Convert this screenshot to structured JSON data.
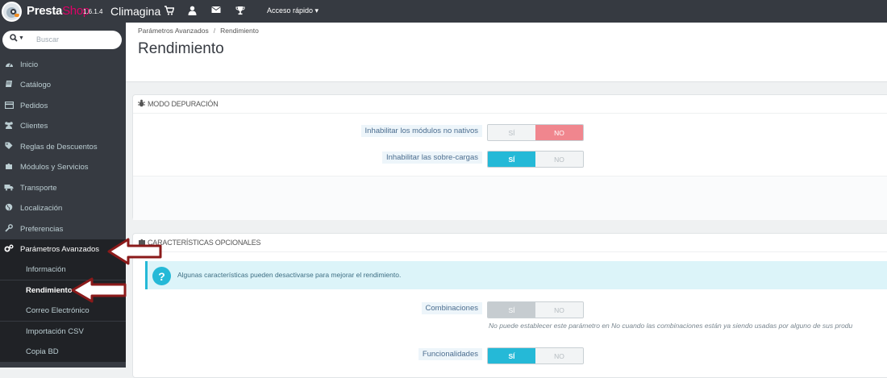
{
  "topbar": {
    "brand_part1": "Presta",
    "brand_part2": "Shop",
    "version": "1.6.1.4",
    "shop_name": "Climagina",
    "icons": [
      "cart-icon",
      "user-icon",
      "mail-icon",
      "trophy-icon"
    ],
    "quick_access": "Acceso rápido ▾"
  },
  "search": {
    "placeholder": "Buscar"
  },
  "sidebar": {
    "items": [
      {
        "label": "Inicio",
        "icon": "dashboard-icon"
      },
      {
        "label": "Catálogo",
        "icon": "book-icon"
      },
      {
        "label": "Pedidos",
        "icon": "credit-card-icon"
      },
      {
        "label": "Clientes",
        "icon": "users-icon"
      },
      {
        "label": "Reglas de Descuentos",
        "icon": "tag-icon"
      },
      {
        "label": "Módulos y Servicios",
        "icon": "puzzle-icon"
      },
      {
        "label": "Transporte",
        "icon": "truck-icon"
      },
      {
        "label": "Localización",
        "icon": "globe-icon"
      },
      {
        "label": "Preferencias",
        "icon": "wrench-icon"
      },
      {
        "label": "Parámetros Avanzados",
        "icon": "cogs-icon"
      }
    ],
    "subitems": [
      {
        "label": "Información"
      },
      {
        "label": "Rendimiento"
      },
      {
        "label": "Correo Electrónico"
      },
      {
        "label": "Importación CSV"
      },
      {
        "label": "Copia BD"
      }
    ]
  },
  "page": {
    "breadcrumb_1": "Parámetros Avanzados",
    "breadcrumb_sep": "/",
    "breadcrumb_2": "Rendimiento",
    "title": "Rendimiento"
  },
  "debug_panel": {
    "title": "MODO DEPURACIÓN",
    "rows": [
      {
        "label": "Inhabilitar los módulos no nativos",
        "yes": "SÍ",
        "no": "NO",
        "selected": "no"
      },
      {
        "label": "Inhabilitar las sobre-cargas",
        "yes": "SÍ",
        "no": "NO",
        "selected": "yes"
      }
    ]
  },
  "features_panel": {
    "title": "CARACTERÍSTICAS OPCIONALES",
    "alert": "Algunas características pueden desactivarse para mejorar el rendimiento.",
    "rows": [
      {
        "label": "Combinaciones",
        "yes": "SÍ",
        "no": "NO",
        "selected": "yes-disabled"
      },
      {
        "label": "Funcionalidades",
        "yes": "SÍ",
        "no": "NO",
        "selected": "yes"
      }
    ],
    "hint": "No puede establecer este parámetro en No cuando las combinaciones están ya siendo usadas por alguno de sus produ"
  },
  "colors": {
    "accent": "#25b9d7",
    "danger": "#f0868e",
    "sidebar": "#363a41",
    "arrow": "#8b1a1a"
  }
}
